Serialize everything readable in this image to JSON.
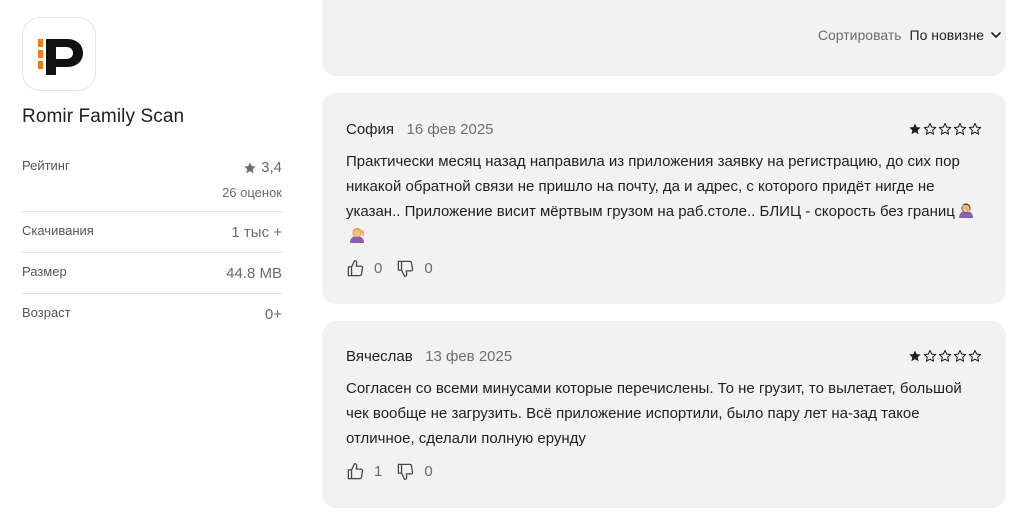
{
  "app": {
    "name": "Romir Family Scan",
    "icon": "romir-logo-icon",
    "colors": {
      "accent": "#f47a14",
      "logo": "#111111"
    }
  },
  "info": {
    "rating_label": "Рейтинг",
    "rating_value": "3,4",
    "rating_count": "26 оценок",
    "downloads_label": "Скачивания",
    "downloads_value": "1 тыс +",
    "size_label": "Размер",
    "size_value": "44.8 MB",
    "age_label": "Возраст",
    "age_value": "0+"
  },
  "sort": {
    "label": "Сортировать",
    "value": "По новизне",
    "icon": "chevron-down-icon"
  },
  "reviews": [
    {
      "author": "София",
      "date": "16 фев 2025",
      "stars_filled": 1,
      "stars_total": 5,
      "text": "Практически месяц назад направила из приложения заявку на регистрацию, до сих пор никакой обратной связи не пришло на почту, да и адрес, с которого придёт нигде не указан.. Приложение висит мёртвым грузом на раб.столе.. БЛИЦ - скорость без границ",
      "emojis": [
        "woman-facepalming-emoji",
        "woman-tipping-hand-emoji"
      ],
      "likes": "0",
      "dislikes": "0"
    },
    {
      "author": "Вячеслав",
      "date": "13 фев 2025",
      "stars_filled": 1,
      "stars_total": 5,
      "text": "Согласен со всеми минусами которые перечислены. То не грузит, то вылетает, большой чек вообще не загрузить. Всё приложение испортили, было пару лет на-зад такое отличное, сделали полную ерунду",
      "likes": "1",
      "dislikes": "0"
    }
  ]
}
